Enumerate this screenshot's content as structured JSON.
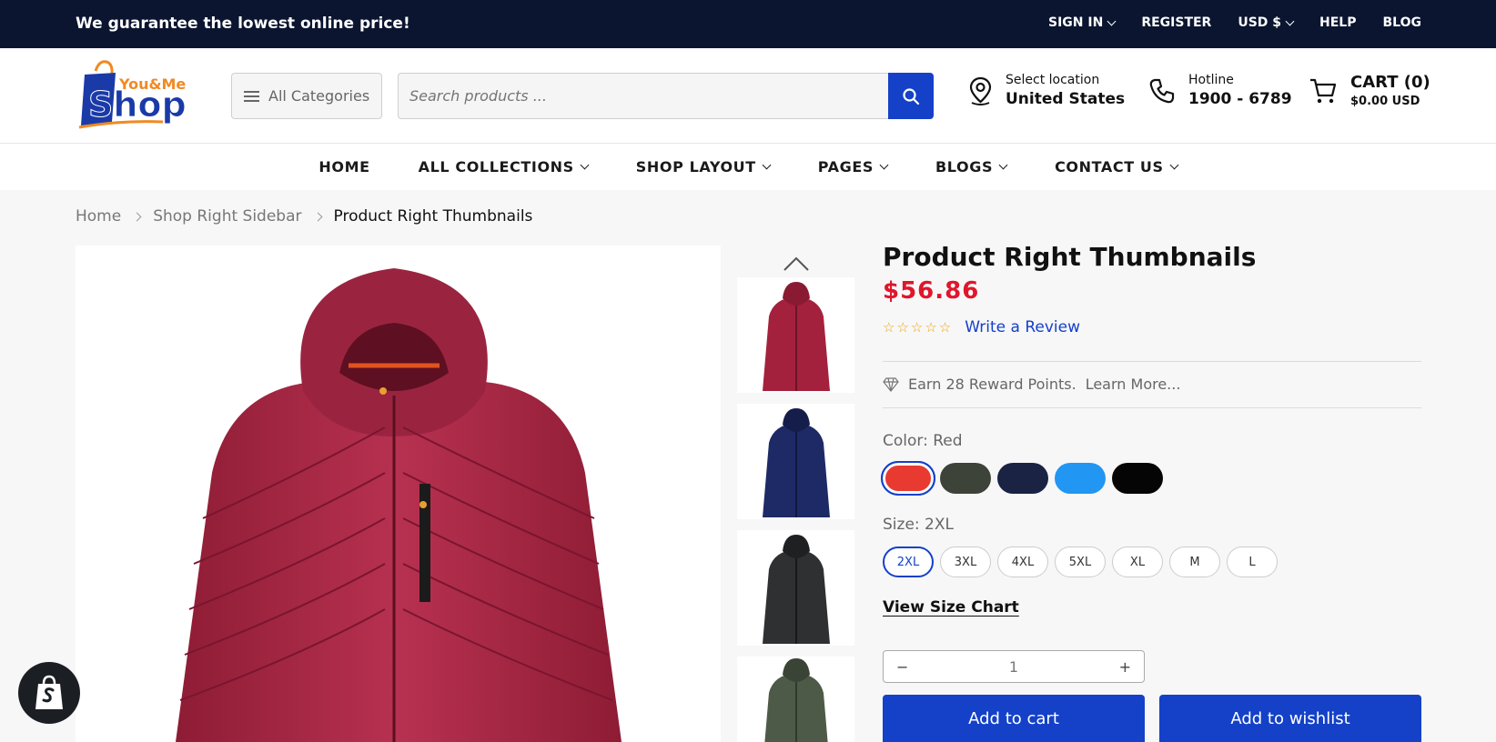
{
  "topbar": {
    "promo": "We guarantee the lowest online price!",
    "sign_in": "SIGN IN",
    "register": "REGISTER",
    "currency": "USD $",
    "help": "HELP",
    "blog": "BLOG"
  },
  "header": {
    "logo_top": "You&Me",
    "logo_main": "Shop",
    "categories_label": "All Categories",
    "search_placeholder": "Search products ...",
    "location_label": "Select location",
    "location_value": "United States",
    "hotline_label": "Hotline",
    "hotline_value": "1900 - 6789",
    "cart_label": "CART (0)",
    "cart_total": "$0.00 USD"
  },
  "nav": {
    "items": [
      {
        "label": "HOME"
      },
      {
        "label": "ALL COLLECTIONS"
      },
      {
        "label": "SHOP LAYOUT"
      },
      {
        "label": "PAGES"
      },
      {
        "label": "BLOGS"
      },
      {
        "label": "CONTACT US"
      }
    ]
  },
  "breadcrumb": {
    "home": "Home",
    "parent": "Shop Right Sidebar",
    "current": "Product Right Thumbnails"
  },
  "product": {
    "title": "Product Right Thumbnails",
    "price": "$56.86",
    "stars": "☆☆☆☆☆",
    "rating": 0,
    "review_link": "Write a Review",
    "reward_text": "Earn 28 Reward Points.",
    "reward_link": "Learn More...",
    "color_label": "Color: Red",
    "colors": [
      "#e83a30",
      "#3d4339",
      "#1b2344",
      "#2196f3",
      "#050505"
    ],
    "size_label": "Size: 2XL",
    "sizes": [
      "2XL",
      "3XL",
      "4XL",
      "5XL",
      "XL",
      "M",
      "L"
    ],
    "size_chart": "View Size Chart",
    "qty_minus": "−",
    "qty_value": "1",
    "qty_plus": "+",
    "add_to_cart": "Add to cart",
    "add_to_wishlist": "Add to wishlist"
  },
  "gallery": {
    "thumb_colors": [
      "#a3213d",
      "#1e2a66",
      "#2e3032",
      "#4e5a48"
    ]
  },
  "colors": {
    "accent": "#1441c8",
    "topbar": "#0b1530",
    "price": "#e0162b"
  }
}
